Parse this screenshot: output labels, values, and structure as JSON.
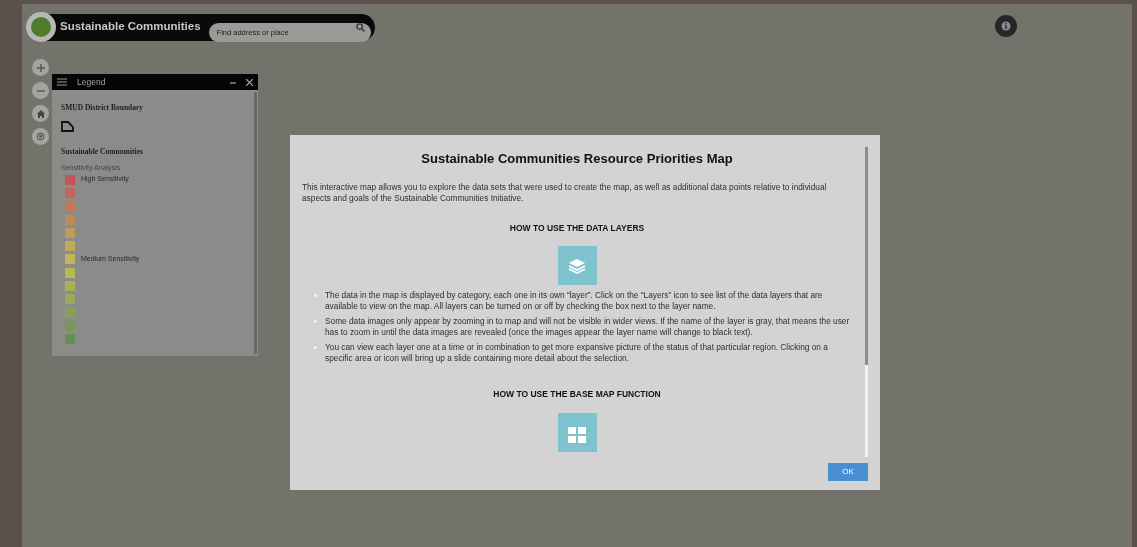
{
  "header": {
    "title": "Sustainable Communities",
    "search": {
      "placeholder": "Find address or place"
    }
  },
  "map_controls": [
    {
      "kind": "zoom-in"
    },
    {
      "kind": "zoom-out"
    },
    {
      "kind": "home"
    },
    {
      "kind": "locate"
    }
  ],
  "legend": {
    "title": "Legend",
    "sections": [
      {
        "title": "SMUD District Boundary",
        "kind": "polygon"
      },
      {
        "title": "Sustainable Communities",
        "kind": "ramp",
        "subtitle": "Sensitivity Analysis",
        "swatches": [
          {
            "color": "#c0545a",
            "label": "High Sensitivity"
          },
          {
            "color": "#c0665a"
          },
          {
            "color": "#c27858"
          },
          {
            "color": "#c08a58"
          },
          {
            "color": "#c09a58"
          },
          {
            "color": "#c0aa58"
          },
          {
            "color": "#c4b658",
            "label": "Medium Sensitivity"
          },
          {
            "color": "#b8b854"
          },
          {
            "color": "#a8b058"
          },
          {
            "color": "#9aa858"
          },
          {
            "color": "#88a058"
          },
          {
            "color": "#789858"
          },
          {
            "color": "#688f58"
          }
        ]
      }
    ]
  },
  "dialog": {
    "title": "Sustainable Communities Resource Priorities Map",
    "intro": "This interactive map allows you to explore the data sets that were used to create the map, as well as additional data points relative to individual aspects and goals of the Sustainable Communities Initiative.",
    "sections": [
      {
        "heading": "HOW TO USE THE DATA LAYERS",
        "kind": "layers",
        "bullets": [
          "The data in the map is displayed by category, each one in its own “layer”. Click on the “Layers” icon to see list of the data layers that are available to view on the map. All layers can be turned on or off by checking the box next to the layer name.",
          "Some data images only appear by zooming in to map and will not be visible in wider views. If the name of the layer is gray, that means the user has to zoom in until the data images are revealed (once the images appear the layer name will change to black text).",
          "You can view each layer one at a time or in combination to get more expansive picture of the status of that particular region. Clicking on a specific area or icon will bring up a slide containing more detail about the selection."
        ]
      },
      {
        "heading": "HOW TO USE THE BASE MAP FUNCTION",
        "kind": "grid"
      }
    ],
    "button": "OK"
  }
}
